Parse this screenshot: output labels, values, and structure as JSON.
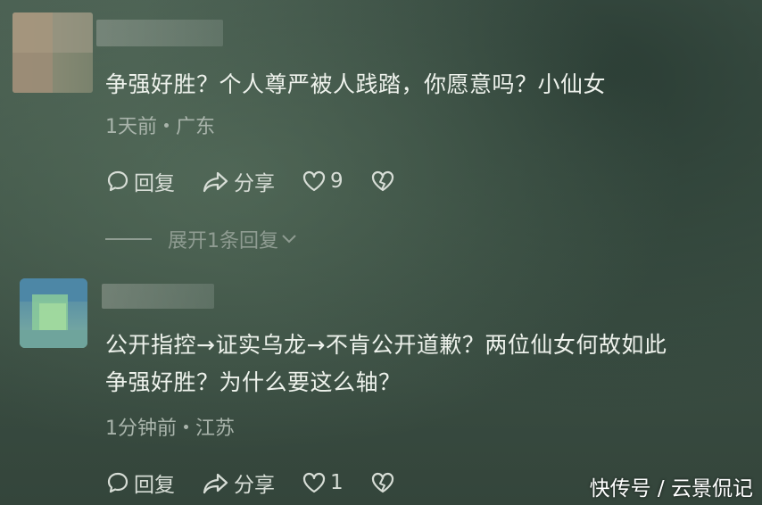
{
  "comments": [
    {
      "text": "争强好胜？个人尊严被人践踏，你愿意吗？小仙女",
      "time": "1天前",
      "location": "广东",
      "reply_label": "回复",
      "share_label": "分享",
      "like_count": "9",
      "expand_label": "展开1条回复"
    },
    {
      "text_line1": "公开指控→证实乌龙→不肯公开道歉？两位仙女何故如此",
      "text_line2": "争强好胜？为什么要这么轴？",
      "time": "1分钟前",
      "location": "江苏",
      "reply_label": "回复",
      "share_label": "分享",
      "like_count": "1"
    }
  ],
  "watermark": "快传号 / 云景侃记",
  "icons": {
    "reply": "speech-bubble-icon",
    "share": "share-arrow-icon",
    "like": "heart-icon",
    "dislike": "broken-heart-icon",
    "expand": "chevron-down-icon"
  }
}
